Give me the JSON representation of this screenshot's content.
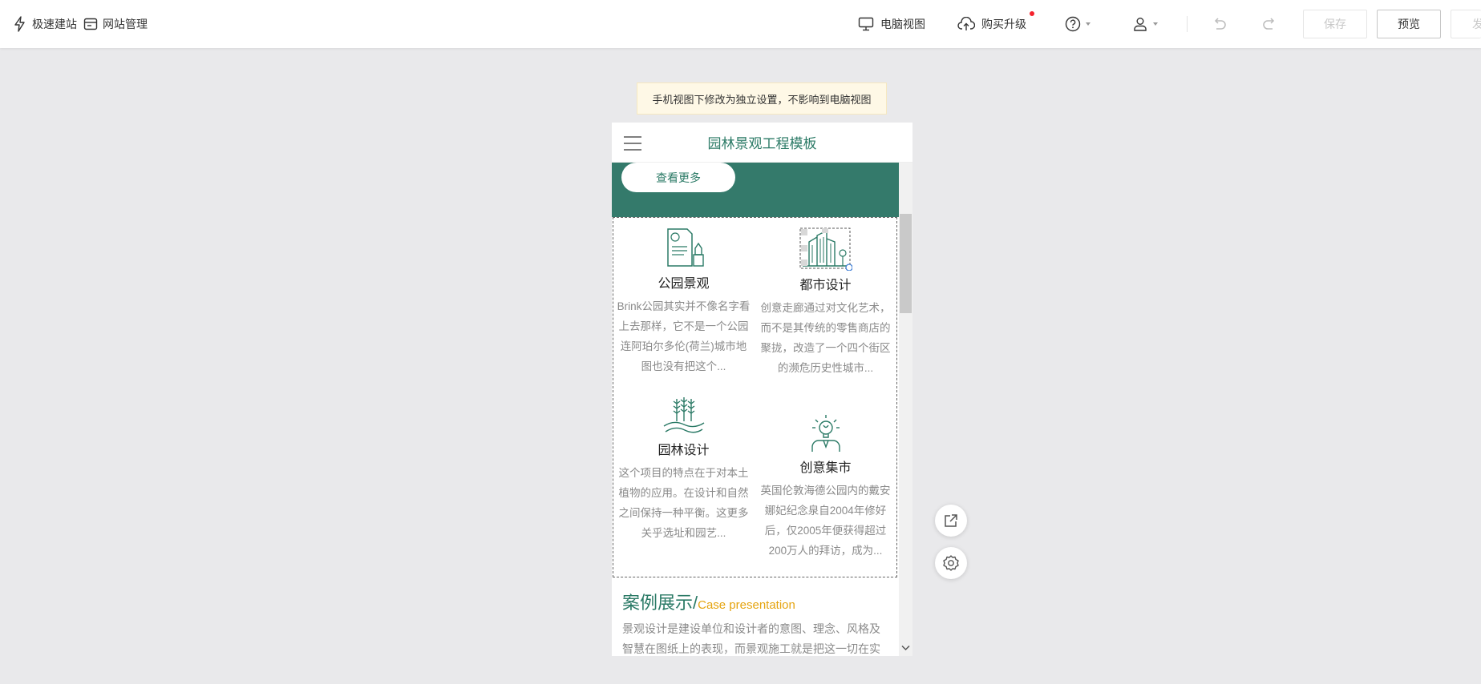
{
  "topbar": {
    "quick_build": "极速建站",
    "site_manage": "网站管理",
    "desktop_view": "电脑视图",
    "buy_upgrade": "购买升级",
    "help_icon": "help-circle-icon",
    "user_icon": "user-icon",
    "save": "保存",
    "preview": "预览",
    "publish_partial": "发"
  },
  "notice": "手机视图下修改为独立设置，不影响到电脑视图",
  "phone": {
    "title": "园林景观工程模板",
    "more_button": "查看更多",
    "features": [
      {
        "name": "公园景观",
        "icon": "document-pen-icon",
        "desc": "Brink公园其实并不像名字看上去那样，它不是一个公园连阿珀尔多伦(荷兰)城市地图也没有把这个..."
      },
      {
        "name": "都市设计",
        "icon": "city-buildings-icon",
        "desc": "创意走廊通过对文化艺术，而不是其传统的零售商店的聚拢，改造了一个四个街区的濒危历史性城市..."
      },
      {
        "name": "园林设计",
        "icon": "wheat-icon",
        "desc": "这个项目的特点在于对本土植物的应用。在设计和自然之间保持一种平衡。这更多关乎选址和园艺..."
      },
      {
        "name": "创意集市",
        "icon": "idea-person-icon",
        "desc": "英国伦敦海德公园内的戴安娜妃纪念泉自2004年修好后，仅2005年便获得超过200万人的拜访，成为..."
      }
    ],
    "case": {
      "title_cn": "案例展示/",
      "title_en": "Case presentation",
      "desc": "景观设计是建设单位和设计者的意图、理念、风格及智慧在图纸上的表现，而景观施工就是把这一切在实"
    }
  },
  "colors": {
    "brand_green": "#347a6b",
    "title_green": "#2b7a66",
    "accent_orange": "#e5a410",
    "notice_bg": "#fef8e6"
  }
}
